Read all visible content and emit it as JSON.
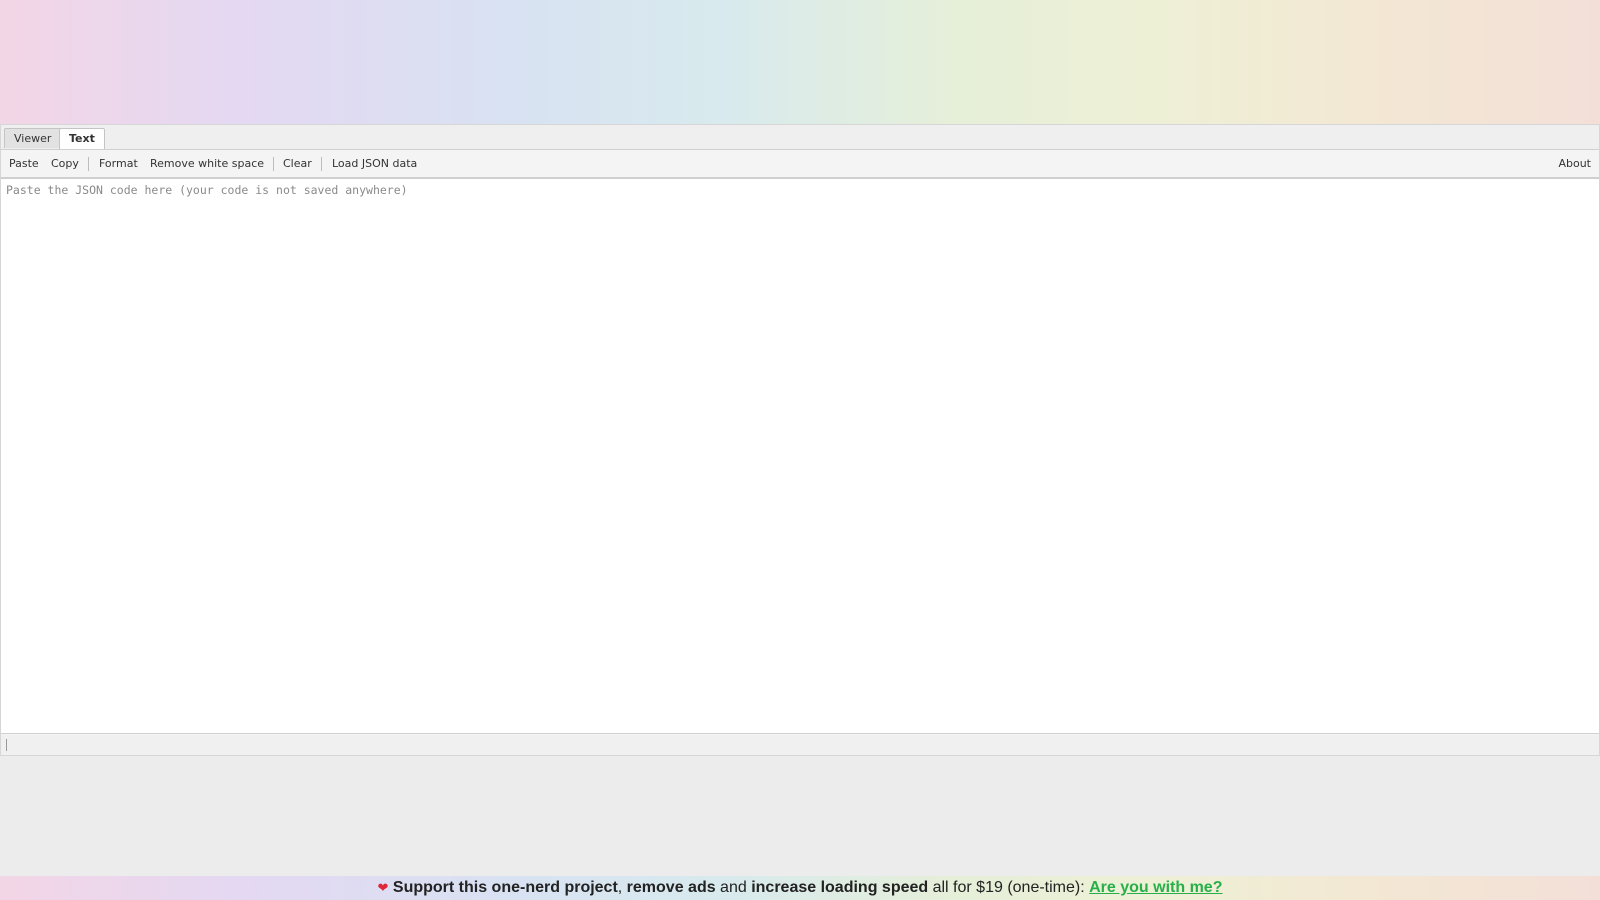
{
  "tabs": [
    {
      "label": "Viewer",
      "active": false
    },
    {
      "label": "Text",
      "active": true
    }
  ],
  "toolbar": {
    "paste": "Paste",
    "copy": "Copy",
    "format": "Format",
    "remove_white_space": "Remove white space",
    "clear": "Clear",
    "load_json_data": "Load JSON data",
    "about": "About"
  },
  "editor": {
    "value": "",
    "placeholder": "Paste the JSON code here (your code is not saved anywhere)"
  },
  "support": {
    "heart_icon": "heart-icon",
    "part1": "Support this one-nerd project",
    "comma": ", ",
    "part2": "remove ads",
    "and": " and ",
    "part3": "increase loading speed",
    "price_text": " all for $19 (one-time): ",
    "link": "Are you with me?"
  },
  "colors": {
    "support_link": "#27b04a",
    "heart": "#e0283b"
  }
}
